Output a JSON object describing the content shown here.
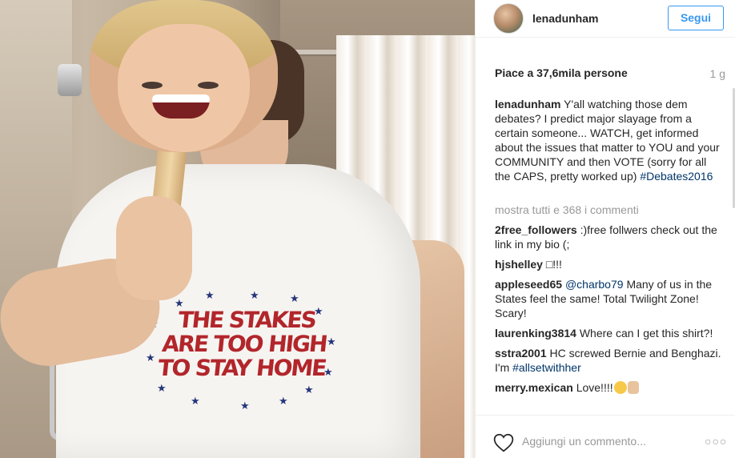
{
  "post": {
    "username": "lenadunham",
    "follow_label": "Segui",
    "likes": "Piace a 37,6mila persone",
    "time": "1 g",
    "caption": {
      "username": "lenadunham",
      "text": "Y'all watching those dem debates? I predict major slayage from a certain someone... WATCH, get informed about the issues that matter to YOU and your COMMUNITY and then VOTE (sorry for all the CAPS, pretty worked up)",
      "hashtag": "#Debates2016"
    },
    "show_all_comments": "mostra tutti e 368 i commenti"
  },
  "comments": [
    {
      "username": "2free_followers",
      "text": ":)free follwers check out the link in my bio (;"
    },
    {
      "username": "hjshelley",
      "text": "□!!!"
    },
    {
      "username": "appleseed65",
      "mention": "@charbo79",
      "text": "Many of us in the States feel the same! Total Twilight Zone! Scary!"
    },
    {
      "username": "laurenking3814",
      "text": "Where can I get this shirt?!"
    },
    {
      "username": "sstra2001",
      "text": "HC screwed Bernie and Benghazi. I'm",
      "hashtag": "#allsetwithher"
    },
    {
      "username": "merry.mexican",
      "text": "Love!!!!"
    }
  ],
  "footer": {
    "comment_placeholder": "Aggiungi un commento...",
    "more_label": "○○○",
    "like_icon": "heart-outline-icon"
  },
  "photo": {
    "shirt_text": [
      "THE STAKES",
      "ARE TOO HIGH",
      "TO STAY HOME"
    ]
  },
  "colors": {
    "accent": "#3897f0",
    "hashtag": "#003569",
    "muted": "#999999",
    "shirt_red": "#b2262b",
    "star_blue": "#25357a"
  }
}
